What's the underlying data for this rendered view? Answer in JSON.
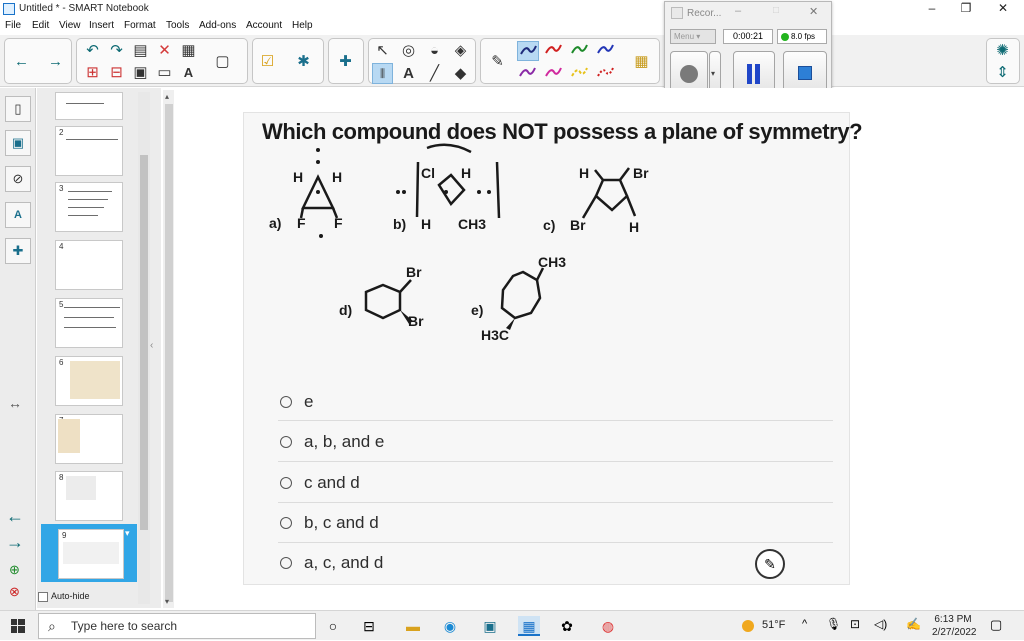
{
  "window": {
    "title": "Untitled * - SMART Notebook",
    "minimize": "–",
    "restore": "❐",
    "close": "✕"
  },
  "menubar": [
    "File",
    "Edit",
    "View",
    "Insert",
    "Format",
    "Tools",
    "Add-ons",
    "Account",
    "Help"
  ],
  "recorder": {
    "title": "Recor...",
    "menu_label": "Menu",
    "elapsed": "0:00:21",
    "fps": "8.0 fps",
    "status_color": "#22b41e"
  },
  "sorter": {
    "pages": [
      "",
      "2",
      "3",
      "4",
      "5",
      "6",
      "7",
      "8",
      "9"
    ],
    "selected_page": "9",
    "auto_hide_label": "Auto-hide"
  },
  "question": {
    "text": "Which compound does NOT possess a plane of symmetry?",
    "structure_labels": {
      "a_atoms": [
        "H",
        "H",
        "F",
        "F"
      ],
      "a_label": "a)",
      "b_atoms": [
        "Cl",
        "H",
        "H",
        "CH3"
      ],
      "b_label": "b)",
      "c_atoms": [
        "H",
        "Br",
        "Br",
        "H"
      ],
      "c_label": "c)",
      "d_atoms": [
        "Br",
        "Br"
      ],
      "d_label": "d)",
      "e_atoms": [
        "CH3",
        "H3C"
      ],
      "e_label": "e)"
    },
    "options": [
      "e",
      "a, b, and e",
      "c and d",
      "b, c and d",
      "a, c, and d"
    ]
  },
  "taskbar": {
    "search_placeholder": "Type here to search",
    "weather": "51°F",
    "time": "6:13 PM",
    "date": "2/27/2022"
  },
  "colors": {
    "accent": "#1a73c9",
    "pen_colors": [
      "#1e2a7a",
      "#d02020",
      "#1d8a2a",
      "#2336b6",
      "#8a2aa6",
      "#d02a9e",
      "#e7c21a",
      "#d02020"
    ]
  }
}
